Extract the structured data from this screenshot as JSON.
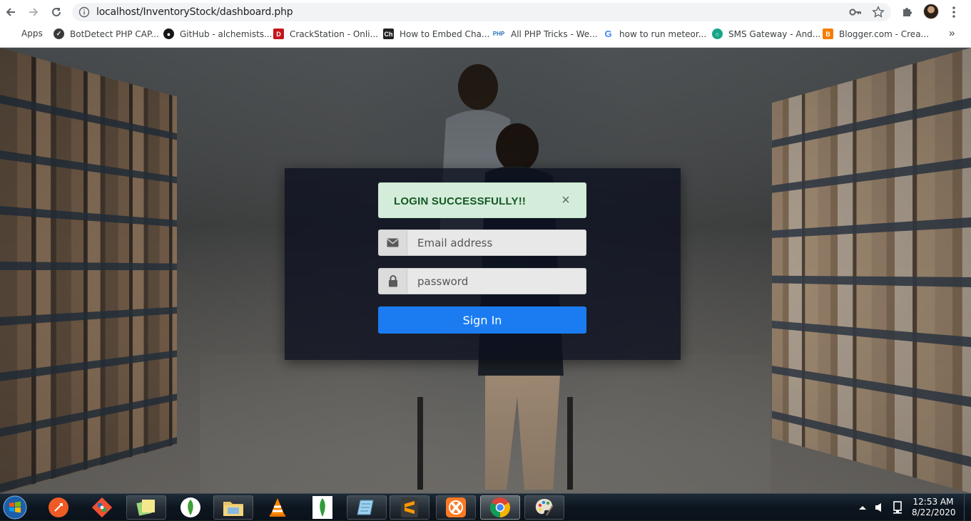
{
  "browser": {
    "url": "localhost/InventoryStock/dashboard.php",
    "bookmarks": [
      {
        "label": "Apps",
        "icon": "apps-grid-icon",
        "color": "#e8453c"
      },
      {
        "label": "BotDetect PHP CAP...",
        "icon": "botdetect-icon",
        "color": "#3a3a3a"
      },
      {
        "label": "GitHub - alchemists...",
        "icon": "github-icon",
        "color": "#161616"
      },
      {
        "label": "CrackStation - Onli...",
        "icon": "crackstation-icon",
        "color": "#c4161c"
      },
      {
        "label": "How to Embed Cha...",
        "icon": "chartjs-icon",
        "color": "#222222"
      },
      {
        "label": "All PHP Tricks - We...",
        "icon": "php-icon",
        "color": "#2a6fb7"
      },
      {
        "label": "how to run meteor...",
        "icon": "google-icon",
        "color": "#4285f4"
      },
      {
        "label": "SMS Gateway - And...",
        "icon": "sms-gateway-icon",
        "color": "#17a589"
      },
      {
        "label": "Blogger.com - Crea...",
        "icon": "blogger-icon",
        "color": "#f57d00"
      }
    ],
    "more": "»"
  },
  "login": {
    "alert_text": "LOGIN SUCCESSFULLY!!",
    "close": "×",
    "email_placeholder": "Email address",
    "password_placeholder": "password",
    "signin_label": "Sign In",
    "button_color": "#1b7cf2",
    "alert_color": "#d4edda"
  },
  "taskbar": {
    "apps": [
      {
        "name": "postman-app",
        "icon": "postman-icon"
      },
      {
        "name": "git-app",
        "icon": "git-icon"
      },
      {
        "name": "sticky-notes-app",
        "icon": "sticky-notes-icon"
      },
      {
        "name": "mongodb-app",
        "icon": "mongodb-icon"
      },
      {
        "name": "file-explorer-app",
        "icon": "folder-icon"
      },
      {
        "name": "vlc-app",
        "icon": "vlc-cone-icon"
      },
      {
        "name": "mongodb-compass-app",
        "icon": "mongodb-leaf-icon"
      },
      {
        "name": "notepad-app",
        "icon": "notepad-icon"
      },
      {
        "name": "sublime-text-app",
        "icon": "sublime-text-icon"
      },
      {
        "name": "xampp-app",
        "icon": "xampp-icon"
      },
      {
        "name": "chrome-app",
        "icon": "chrome-icon"
      },
      {
        "name": "paint-app",
        "icon": "paint-palette-icon"
      }
    ],
    "time": "12:53 AM",
    "date": "8/22/2020"
  }
}
